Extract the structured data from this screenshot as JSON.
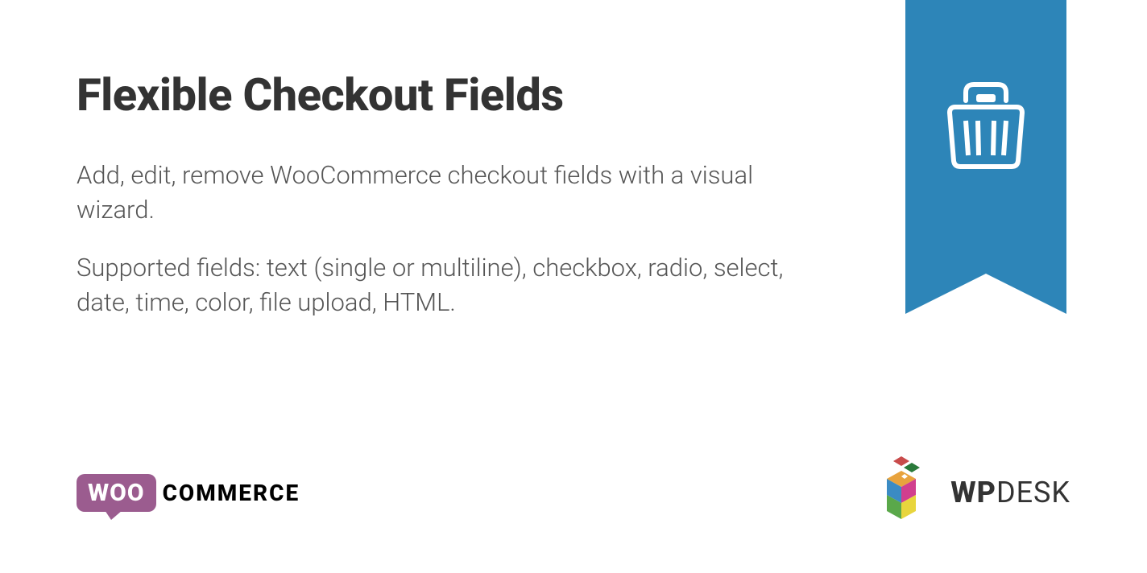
{
  "title": "Flexible Checkout Fields",
  "description1": "Add, edit, remove WooCommerce checkout fields with a visual wizard.",
  "description2": "Supported fields: text (single or multiline), checkbox, radio, select, date, time, color, file upload, HTML.",
  "wooLogo": {
    "bubble": "WOO",
    "text": "COMMERCE"
  },
  "wpdeskLogo": {
    "wp": "WP",
    "desk": "DESK"
  }
}
